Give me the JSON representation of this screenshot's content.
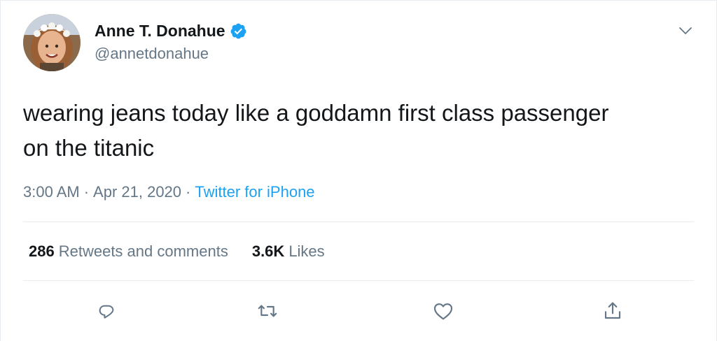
{
  "user": {
    "display_name": "Anne T. Donahue",
    "handle": "@annetdonahue",
    "verified": true,
    "avatar_icon": "avatar-photo"
  },
  "tweet": {
    "text": "wearing jeans today like a goddamn first class passenger\non the titanic",
    "time": "3:00 AM",
    "separator": "·",
    "date": "Apr 21, 2020",
    "source": "Twitter for iPhone"
  },
  "stats": {
    "retweets_count": "286",
    "retweets_label": "Retweets and comments",
    "likes_count": "3.6K",
    "likes_label": "Likes"
  },
  "icons": {
    "more": "chevron-down-icon",
    "reply": "reply-icon",
    "retweet": "retweet-icon",
    "like": "heart-icon",
    "share": "share-icon",
    "verified": "verified-badge-icon"
  },
  "colors": {
    "text": "#14171a",
    "secondary": "#657786",
    "accent": "#1da1f2",
    "divider": "#e6ecf0"
  }
}
